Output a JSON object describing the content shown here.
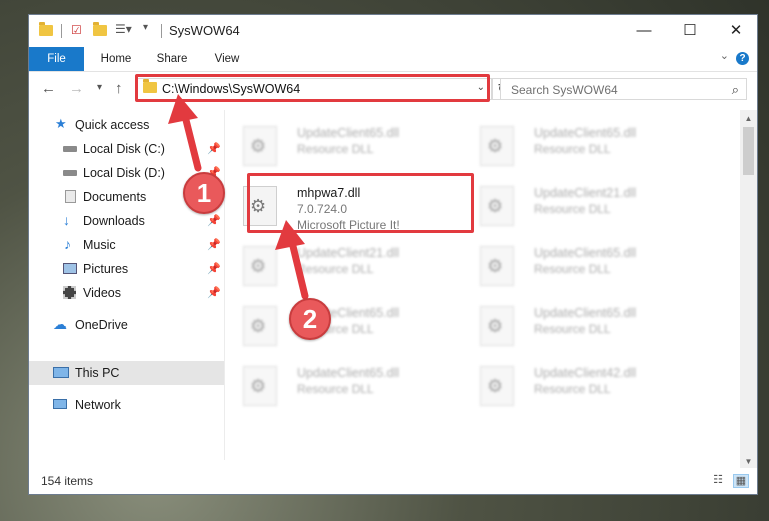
{
  "window": {
    "title": "SysWOW64",
    "controls": {
      "minimize": "—",
      "maximize": "☐",
      "close": "✕"
    }
  },
  "ribbon": {
    "tabs": [
      {
        "label": "File",
        "active": true
      },
      {
        "label": "Home"
      },
      {
        "label": "Share"
      },
      {
        "label": "View"
      }
    ],
    "help": "?"
  },
  "nav": {
    "address": "C:\\Windows\\SysWOW64",
    "search_placeholder": "Search SysWOW64"
  },
  "sidebar": {
    "items": [
      {
        "label": "Quick access",
        "icon": "star-icon"
      },
      {
        "label": "Local Disk (C:)",
        "icon": "drive-icon",
        "pinned": true
      },
      {
        "label": "Local Disk (D:)",
        "icon": "drive-icon",
        "pinned": true
      },
      {
        "label": "Documents",
        "icon": "documents-icon",
        "pinned": true
      },
      {
        "label": "Downloads",
        "icon": "download-icon",
        "pinned": true
      },
      {
        "label": "Music",
        "icon": "music-icon",
        "pinned": true
      },
      {
        "label": "Pictures",
        "icon": "pictures-icon",
        "pinned": true
      },
      {
        "label": "Videos",
        "icon": "videos-icon",
        "pinned": true
      },
      {
        "label": "OneDrive",
        "icon": "cloud-icon"
      },
      {
        "label": "This PC",
        "icon": "computer-icon",
        "selected": true
      },
      {
        "label": "Network",
        "icon": "network-icon"
      }
    ]
  },
  "files": {
    "highlighted": {
      "name": "mhpwa7.dll",
      "version": "7.0.724.0",
      "description": "Microsoft Picture It!"
    },
    "blurred": [
      {
        "name": "UpdateClient65.dll",
        "desc": "Resource DLL"
      },
      {
        "name": "UpdateClient65.dll",
        "desc": "Resource DLL"
      },
      {
        "name": "UpdateClient21.dll",
        "desc": "Resource DLL"
      },
      {
        "name": "UpdateClient21.dll",
        "desc": "Resource DLL"
      },
      {
        "name": "UpdateClient65.dll",
        "desc": "Resource DLL"
      },
      {
        "name": "UpdateClient65.dll",
        "desc": "Resource DLL"
      },
      {
        "name": "UpdateClient65.dll",
        "desc": "Resource DLL"
      },
      {
        "name": "UpdateClient65.dll",
        "desc": "Resource DLL"
      },
      {
        "name": "UpdateClient65.dll",
        "desc": "Resource DLL"
      },
      {
        "name": "UpdateClient42.dll",
        "desc": "Resource DLL"
      }
    ]
  },
  "status": {
    "item_count": "154 items"
  },
  "annotations": {
    "step1": "1",
    "step2": "2",
    "color": "#e23a3f"
  }
}
